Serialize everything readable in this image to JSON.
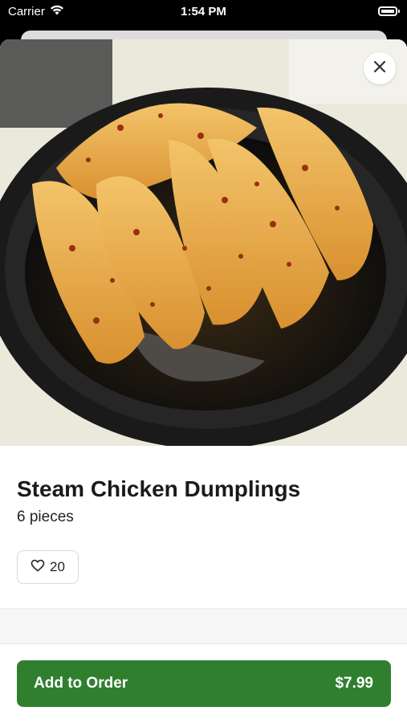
{
  "status_bar": {
    "carrier": "Carrier",
    "time": "1:54 PM"
  },
  "item": {
    "title": "Steam Chicken Dumplings",
    "subtitle": "6 pieces",
    "likes": "20",
    "image": "fried-dumplings-in-black-bowl"
  },
  "actions": {
    "close_icon": "close-icon",
    "add_label": "Add to Order",
    "price": "$7.99"
  },
  "colors": {
    "primary": "#2f7f2f",
    "status_bar_bg": "#000000"
  }
}
